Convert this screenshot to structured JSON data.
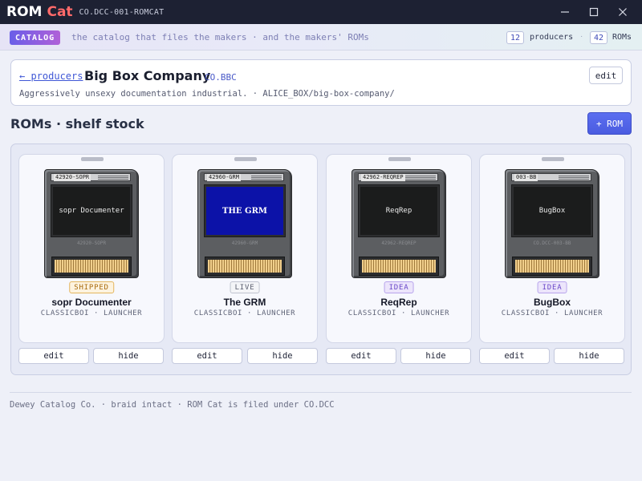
{
  "titlebar": {
    "app_name_a": "ROM",
    "app_name_b": "Cat",
    "app_code": "CO.DCC-001-ROMCAT"
  },
  "banner": {
    "badge": "CATALOG",
    "tagline": "the catalog that files the makers · and the makers' ROMs",
    "producers_count": "12",
    "producers_label": "producers",
    "roms_count": "42",
    "roms_label": "ROMs"
  },
  "producer": {
    "back_label": "← producers",
    "name": "Big Box Company",
    "code": "CO.BBC",
    "description": "Aggressively unsexy documentation industrial. · ALICE_BOX/big-box-company/",
    "edit_label": "edit"
  },
  "section": {
    "title": "ROMs · shelf stock",
    "add_label": "+ ROM"
  },
  "roms": [
    {
      "id": "42920-SOPR",
      "screen": "sopr Documenter",
      "emboss": "42920-SOPR",
      "status": "SHIPPED",
      "name": "sopr Documenter",
      "meta": "CLASSICBOI · LAUNCHER",
      "edit": "edit",
      "hide": "hide"
    },
    {
      "id": "42960-GRM",
      "screen": "THE GRM",
      "emboss": "42960-GRM",
      "status": "LIVE",
      "name": "The GRM",
      "meta": "CLASSICBOI · LAUNCHER",
      "edit": "edit",
      "hide": "hide"
    },
    {
      "id": "42962-REQREP",
      "screen": "ReqRep",
      "emboss": "42962-REQREP",
      "status": "IDEA",
      "name": "ReqRep",
      "meta": "CLASSICBOI · LAUNCHER",
      "edit": "edit",
      "hide": "hide"
    },
    {
      "id": "003-BB",
      "screen": "BugBox",
      "emboss": "CO.DCC-003-BB",
      "status": "IDEA",
      "name": "BugBox",
      "meta": "CLASSICBOI · LAUNCHER",
      "edit": "edit",
      "hide": "hide"
    }
  ],
  "footer": {
    "text": "Dewey Catalog Co. · braid intact · ROM Cat is filed under CO.DCC"
  },
  "colors": {
    "titlebar_bg": "#1d2133",
    "accent": "#4a5ce0",
    "cat_red": "#ff6a6a"
  }
}
